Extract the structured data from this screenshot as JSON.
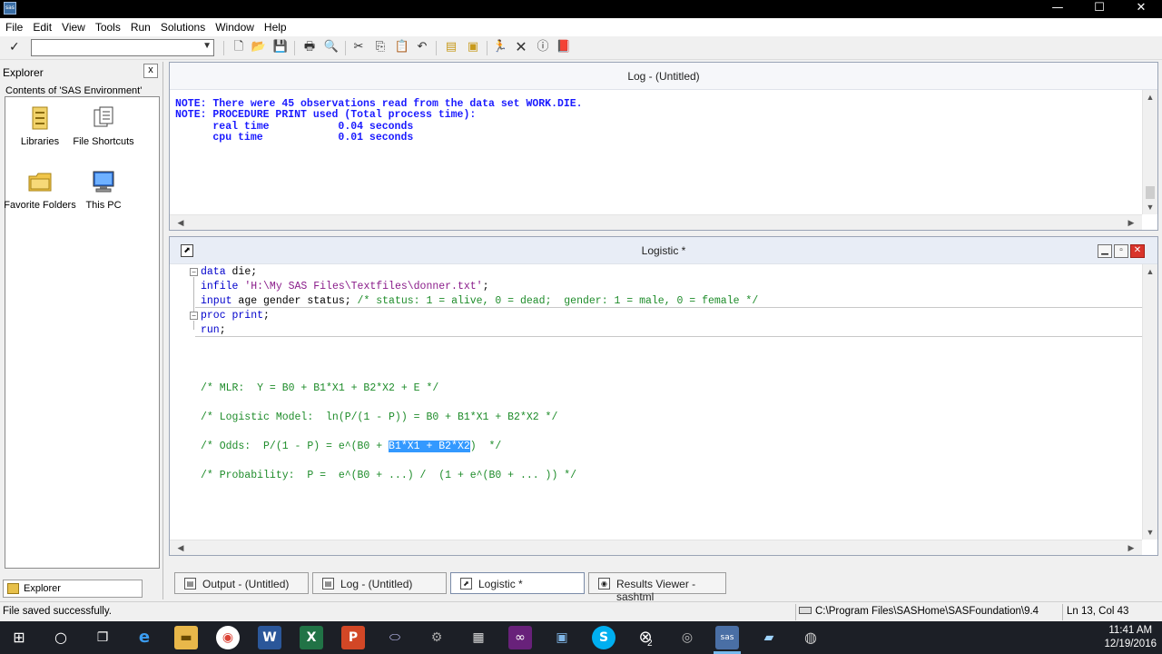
{
  "menu": [
    "File",
    "Edit",
    "View",
    "Tools",
    "Run",
    "Solutions",
    "Window",
    "Help"
  ],
  "titlebar": {
    "app_icon_text": "sas",
    "minimize": "—",
    "maximize": "☐",
    "close": "✕"
  },
  "toolbar": {
    "command_value": ""
  },
  "explorer": {
    "title": "Explorer",
    "close": "x",
    "contents_label": "Contents of 'SAS Environment'",
    "items": [
      {
        "label": "Libraries",
        "icon": "library-icon"
      },
      {
        "label": "File Shortcuts",
        "icon": "file-shortcuts-icon"
      },
      {
        "label": "Favorite Folders",
        "icon": "favorite-folders-icon"
      },
      {
        "label": "This PC",
        "icon": "computer-icon"
      }
    ],
    "tab_label": "Explorer"
  },
  "log_window": {
    "title": "Log - (Untitled)",
    "lines": [
      "NOTE: There were 45 observations read from the data set WORK.DIE.",
      "NOTE: PROCEDURE PRINT used (Total process time):",
      "      real time           0.04 seconds",
      "      cpu time            0.01 seconds"
    ]
  },
  "editor": {
    "title": "Logistic *",
    "code": {
      "l1_kw": "data",
      "l1_rest": " die;",
      "l2_kw": "infile",
      "l2_str": " 'H:\\My SAS Files\\Textfiles\\donner.txt'",
      "l2_end": ";",
      "l3_kw": "input",
      "l3_rest": " age gender status; ",
      "l3_cmt": "/* status: 1 = alive, 0 = dead;  gender: 1 = male, 0 = female */",
      "l4_kw": "proc print",
      "l4_rest": ";",
      "l5_kw": "run",
      "l5_rest": ";",
      "c1": "/* MLR:  Y = B0 + B1*X1 + B2*X2 + E */",
      "c2": "/* Logistic Model:  ln(P/(1 - P)) = B0 + B1*X1 + B2*X2 */",
      "c3_pre": "/* Odds:  P/(1 - P) = e^(B0 + ",
      "c3_sel": "B1*X1 + B2*X2",
      "c3_post": ")  */",
      "c4": "/* Probability:  P =  e^(B0 + ...) /  (1 + e^(B0 + ... )) */"
    }
  },
  "tabs": [
    {
      "label": "Output - (Untitled)"
    },
    {
      "label": "Log - (Untitled)"
    },
    {
      "label": "Logistic *"
    },
    {
      "label": "Results Viewer - sashtml"
    }
  ],
  "status": {
    "message": "File saved successfully.",
    "path": "C:\\Program Files\\SASHome\\SASFoundation\\9.4",
    "position": "Ln 13, Col 43"
  },
  "clock": {
    "time": "11:41 AM",
    "date": "12/19/2016"
  },
  "taskbar_badge": "2"
}
